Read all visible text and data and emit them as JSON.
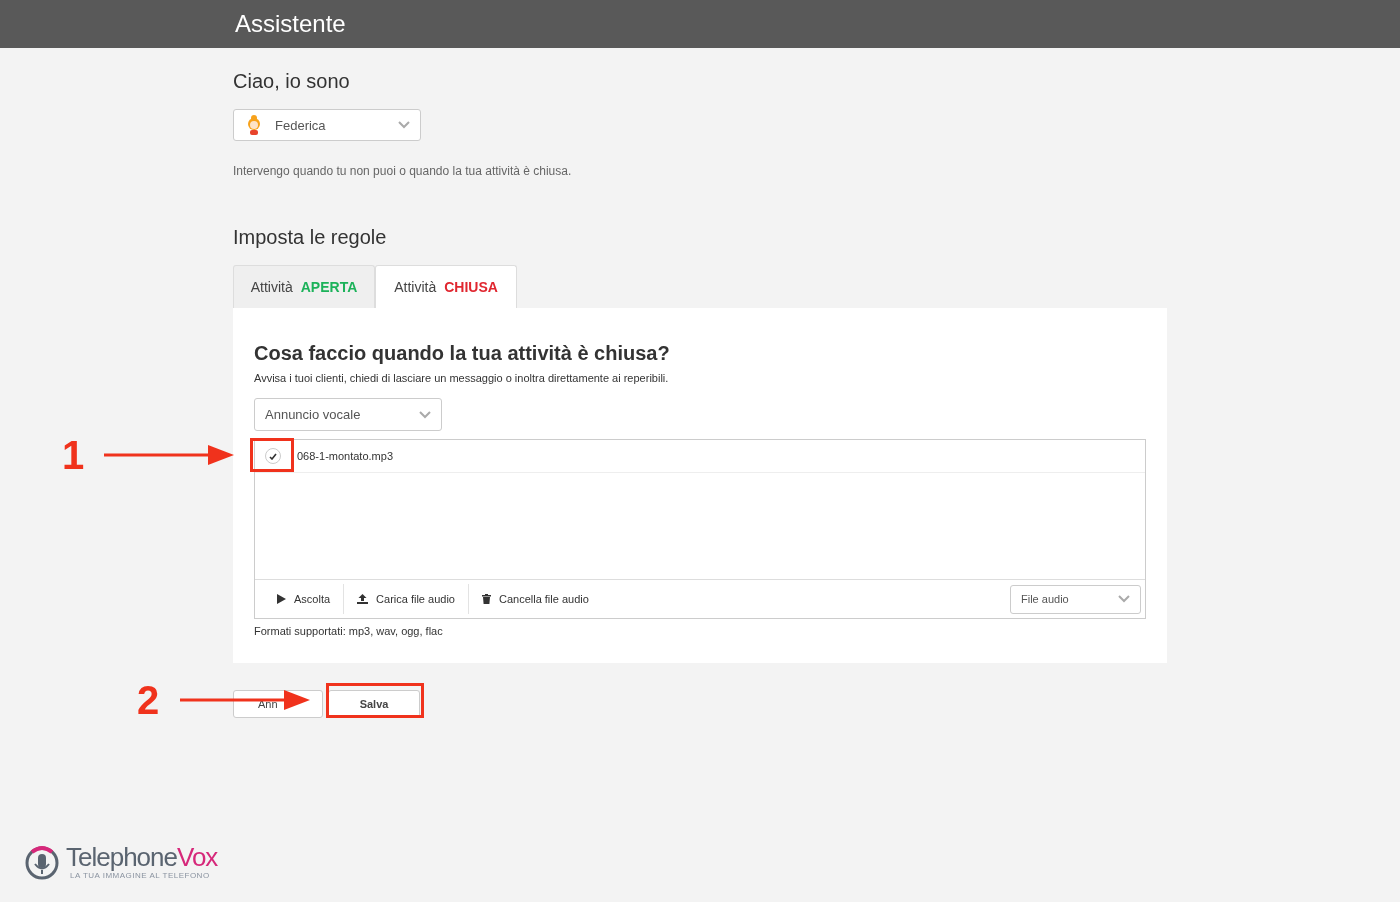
{
  "header": {
    "title": "Assistente"
  },
  "intro": {
    "heading": "Ciao, io sono",
    "assistant_select": {
      "value": "Federica"
    },
    "description": "Intervengo quando tu non puoi o quando la tua attività è chiusa."
  },
  "rules": {
    "heading": "Imposta le regole",
    "tabs": [
      {
        "label": "Attività",
        "status": "APERTA",
        "color": "#1cb25a",
        "selected": false
      },
      {
        "label": "Attività",
        "status": "CHIUSA",
        "color": "#e0262f",
        "selected": true
      }
    ]
  },
  "panel": {
    "heading": "Cosa faccio quando la tua attività è chiusa?",
    "subtitle": "Avvisa i tuoi clienti, chiedi di lasciare un messaggio o inoltra direttamente ai reperibili.",
    "action_select": {
      "value": "Annuncio vocale"
    },
    "files": [
      {
        "name": "068-1-montato.mp3",
        "checked": true
      }
    ],
    "toolbar": [
      {
        "label": "Ascolta",
        "kind": "play"
      },
      {
        "label": "Carica file audio",
        "kind": "upload"
      },
      {
        "label": "Cancella file audio",
        "kind": "delete"
      }
    ],
    "type_select": {
      "value": "File audio"
    },
    "formats_note": "Formati supportati: mp3, wav, ogg, flac"
  },
  "buttons": [
    {
      "label": "Ann",
      "kind": "secondary"
    },
    {
      "label": "Salva",
      "kind": "primary"
    }
  ],
  "annotations": [
    {
      "label": "1"
    },
    {
      "label": "2"
    }
  ],
  "logo": {
    "name_first": "Telephone",
    "name_second": "Vox",
    "tagline": "LA TUA IMMAGINE AL TELEFONO"
  }
}
